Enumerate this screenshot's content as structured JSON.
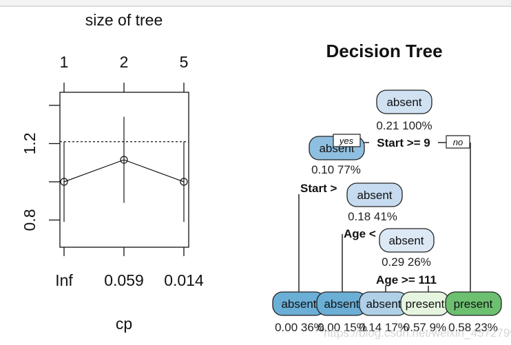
{
  "chart_data": [
    {
      "type": "line",
      "title": "size of tree",
      "xlabel": "cp",
      "ylabel": "",
      "top_axis_label_ticks": [
        "1",
        "2",
        "5"
      ],
      "bottom_axis_ticks": [
        "Inf",
        "0.059",
        "0.014"
      ],
      "y_ticks": [
        0.8,
        1.0,
        1.2,
        1.4
      ],
      "y_tick_labels": [
        "0.8",
        "1.2"
      ],
      "ylim": [
        0.64,
        1.5
      ],
      "series": [
        {
          "x": [
            "Inf",
            "0.059",
            "0.014"
          ],
          "values": [
            1.0,
            1.115,
            1.0
          ],
          "error_lower": [
            0.79,
            0.89,
            0.79
          ],
          "error_upper": [
            1.21,
            1.34,
            1.21
          ]
        }
      ],
      "reference_line": 1.21,
      "grid": false
    },
    {
      "type": "tree",
      "title": "Decision Tree",
      "nodes": [
        {
          "label": "absent",
          "stats": "0.21  100%",
          "color": "#d0e1f2"
        },
        {
          "label": "absent",
          "stats": "0.10  77%",
          "color": "#8fbfe0"
        },
        {
          "label": "absent",
          "stats": "0.18  41%",
          "color": "#c6dbef"
        },
        {
          "label": "absent",
          "stats": "0.29  26%",
          "color": "#dde8f5"
        }
      ],
      "splits": [
        "Start >= 9",
        "Start >",
        "Age <",
        "Age >= 111"
      ],
      "branch_labels": {
        "yes": "yes",
        "no": "no"
      },
      "leaves": [
        {
          "label": "absent",
          "stats": "0.00  36%",
          "color": "#6baed6"
        },
        {
          "label": "absent",
          "stats": "0.00  15%",
          "color": "#6baed6"
        },
        {
          "label": "absent",
          "stats": "0.14  17%",
          "color": "#b0d0e8"
        },
        {
          "label": "present",
          "stats": "0.57  9%",
          "color": "#e5f5e0"
        },
        {
          "label": "present",
          "stats": "0.58  23%",
          "color": "#6cc070"
        }
      ]
    }
  ],
  "watermark": "https://blog.csdn.net/weixin_45727991"
}
